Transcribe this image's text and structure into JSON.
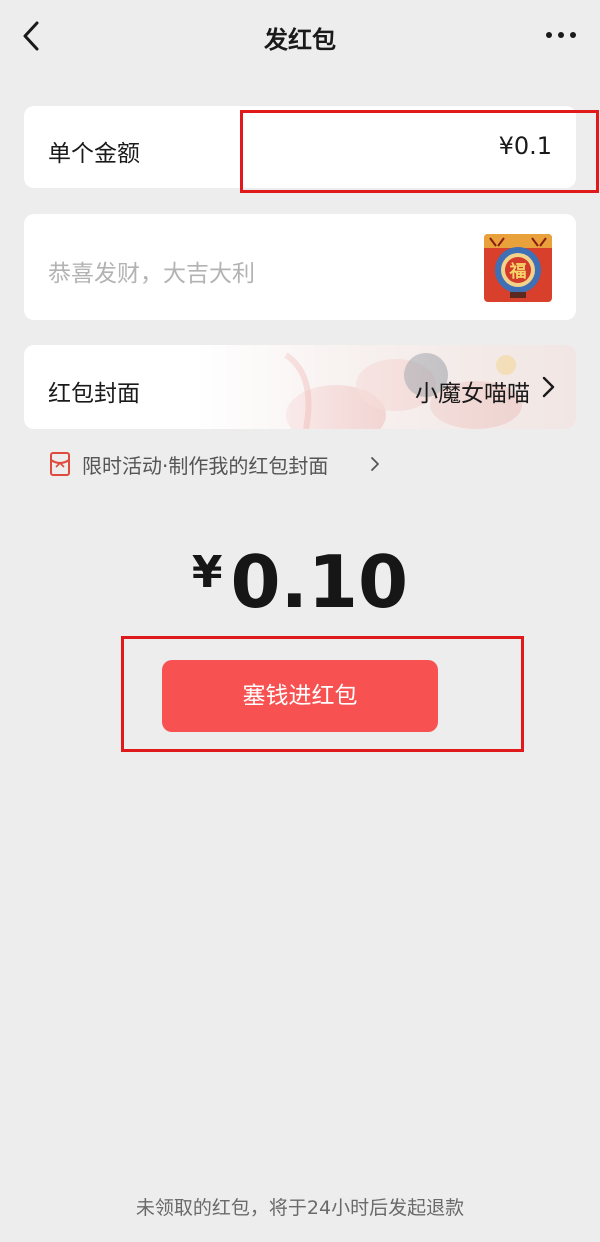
{
  "nav": {
    "title": "发红包",
    "back_icon": "chevron-left-icon",
    "more_icon": "more-icon"
  },
  "amount": {
    "label": "单个金额",
    "value": "¥0.1"
  },
  "greeting": {
    "placeholder": "恭喜发财，大吉大利",
    "sticker_text": "福",
    "sticker_icon": "fu-sticker-icon"
  },
  "cover": {
    "label": "红包封面",
    "value": "小魔女喵喵",
    "chevron_icon": "chevron-right-icon"
  },
  "promo": {
    "icon": "red-packet-icon",
    "text": "限时活动·制作我的红包封面"
  },
  "total": {
    "symbol": "¥",
    "amount": "0.10"
  },
  "send_button": {
    "label": "塞钱进红包"
  },
  "footer": {
    "note": "未领取的红包，将于24小时后发起退款"
  },
  "colors": {
    "background": "#ededed",
    "button": "#f75251",
    "highlight_box": "#e01a1a"
  }
}
